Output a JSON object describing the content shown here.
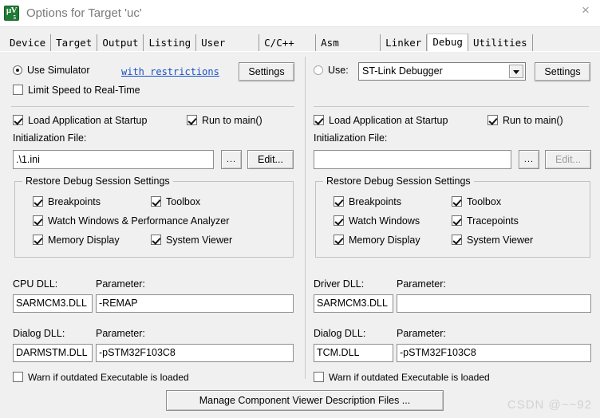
{
  "window": {
    "title": "Options for Target 'uc'",
    "app_icon": "uvision-logo-icon",
    "close_label": "×"
  },
  "tabs": [
    {
      "label": "Device",
      "selected": false
    },
    {
      "label": "Target",
      "selected": false
    },
    {
      "label": "Output",
      "selected": false
    },
    {
      "label": "Listing",
      "selected": false
    },
    {
      "label": "User",
      "selected": false
    },
    {
      "label": "C/C++",
      "selected": false
    },
    {
      "label": "Asm",
      "selected": false
    },
    {
      "label": "Linker",
      "selected": false
    },
    {
      "label": "Debug",
      "selected": true
    },
    {
      "label": "Utilities",
      "selected": false
    }
  ],
  "left": {
    "use_simulator_label": "Use Simulator",
    "use_simulator_checked": true,
    "restrictions_link": "with restrictions",
    "settings_label": "Settings",
    "limit_speed_label": "Limit Speed to Real-Time",
    "limit_speed_checked": false,
    "load_app_label": "Load Application at Startup",
    "load_app_checked": true,
    "run_to_main_label": "Run to main()",
    "run_to_main_checked": true,
    "init_file_caption": "Initialization File:",
    "init_file_value": ".\\1.ini",
    "browse_label": "...",
    "edit_label": "Edit...",
    "group_title": "Restore Debug Session Settings",
    "restore": [
      {
        "label": "Breakpoints",
        "checked": true
      },
      {
        "label": "Toolbox",
        "checked": true
      },
      {
        "label": "Watch Windows & Performance Analyzer",
        "checked": true
      },
      {
        "label": "Memory Display",
        "checked": true
      },
      {
        "label": "System Viewer",
        "checked": true
      }
    ],
    "cpu_dll_caption": "CPU DLL:",
    "cpu_dll_value": "SARMCM3.DLL",
    "cpu_param_caption": "Parameter:",
    "cpu_param_value": "-REMAP",
    "dialog_dll_caption": "Dialog DLL:",
    "dialog_dll_value": "DARMSTM.DLL",
    "dialog_param_caption": "Parameter:",
    "dialog_param_value": "-pSTM32F103C8",
    "warn_label": "Warn if outdated Executable is loaded",
    "warn_checked": false
  },
  "right": {
    "use_label": "Use:",
    "use_checked": false,
    "debugger_value": "ST-Link Debugger",
    "settings_label": "Settings",
    "load_app_label": "Load Application at Startup",
    "load_app_checked": true,
    "run_to_main_label": "Run to main()",
    "run_to_main_checked": true,
    "init_file_caption": "Initialization File:",
    "init_file_value": "",
    "browse_label": "...",
    "edit_label": "Edit...",
    "edit_disabled": true,
    "group_title": "Restore Debug Session Settings",
    "restore": [
      {
        "label": "Breakpoints",
        "checked": true
      },
      {
        "label": "Toolbox",
        "checked": true
      },
      {
        "label": "Watch Windows",
        "checked": true
      },
      {
        "label": "Tracepoints",
        "checked": true
      },
      {
        "label": "Memory Display",
        "checked": true
      },
      {
        "label": "System Viewer",
        "checked": true
      }
    ],
    "driver_dll_caption": "Driver DLL:",
    "driver_dll_value": "SARMCM3.DLL",
    "driver_param_caption": "Parameter:",
    "driver_param_value": "",
    "dialog_dll_caption": "Dialog DLL:",
    "dialog_dll_value": "TCM.DLL",
    "dialog_param_caption": "Parameter:",
    "dialog_param_value": "-pSTM32F103C8",
    "warn_label": "Warn if outdated Executable is loaded",
    "warn_checked": false
  },
  "footer": {
    "manage_button_label": "Manage Component Viewer Description Files ...",
    "watermark": "CSDN @~~92"
  }
}
